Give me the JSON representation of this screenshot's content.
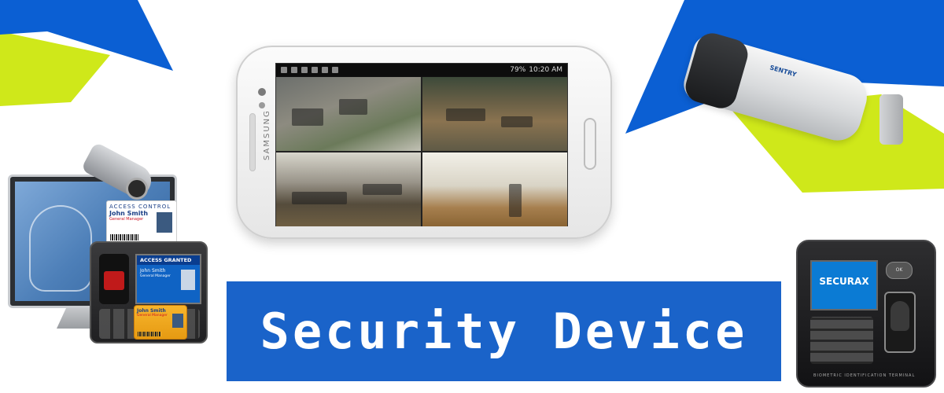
{
  "banner": {
    "title": "Security Device"
  },
  "phone": {
    "status_time": "10:20 AM",
    "status_battery": "79%",
    "brand": "SAMSUNG"
  },
  "access_card": {
    "header": "ACCESS CONTROL",
    "name": "John Smith",
    "role": "General Manager"
  },
  "reader_left": {
    "status": "ACCESS GRANTED",
    "name": "John Smith",
    "role": "General Manager"
  },
  "id_card": {
    "name": "John Smith",
    "role": "General Manager"
  },
  "cctv_right": {
    "brand": "SENTRY"
  },
  "terminal": {
    "brand": "SECURAX",
    "ok_label": "OK",
    "footer": "BIOMETRIC IDENTIFICATION TERMINAL"
  },
  "colors": {
    "banner_blue": "#1a63c9",
    "accent_lime": "#cfe81a",
    "accent_blue": "#0b5fd3"
  }
}
